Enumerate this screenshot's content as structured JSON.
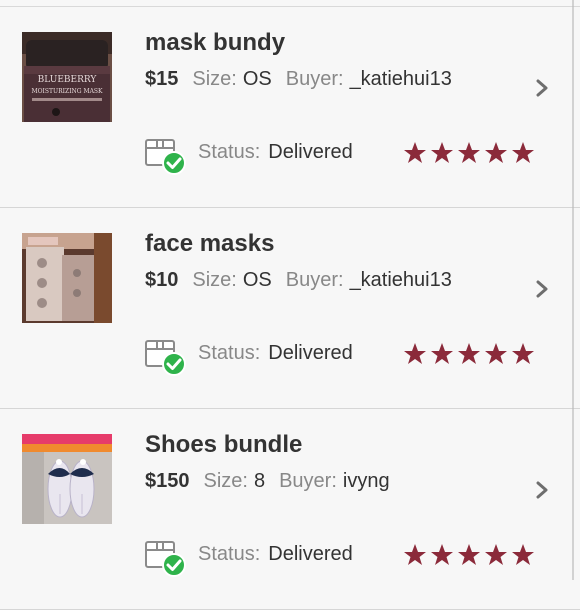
{
  "orders": [
    {
      "title": "mask bundy",
      "price": "$15",
      "size_label": "Size:",
      "size": "OS",
      "buyer_label": "Buyer:",
      "buyer": "_katiehui13",
      "status_label": "Status:",
      "status": "Delivered",
      "rating": 5,
      "thumb_text_1": "BLUEBERRY",
      "thumb_text_2": "MOISTURIZING MASK"
    },
    {
      "title": "face masks",
      "price": "$10",
      "size_label": "Size:",
      "size": "OS",
      "buyer_label": "Buyer:",
      "buyer": "_katiehui13",
      "status_label": "Status:",
      "status": "Delivered",
      "rating": 5
    },
    {
      "title": "Shoes bundle",
      "price": "$150",
      "size_label": "Size:",
      "size": "8",
      "buyer_label": "Buyer:",
      "buyer": "ivyng",
      "status_label": "Status:",
      "status": "Delivered",
      "rating": 5
    }
  ],
  "colors": {
    "star": "#8b2a3a",
    "check": "#2fb34b",
    "chevron": "#6e6e6e"
  }
}
